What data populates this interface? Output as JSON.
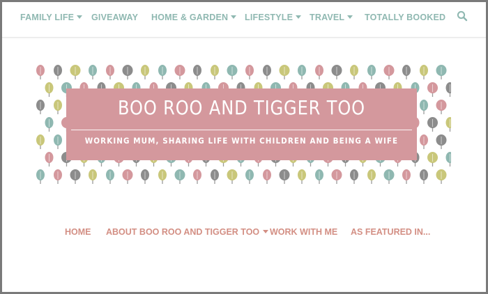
{
  "top_nav": {
    "items": [
      {
        "label": "FAMILY LIFE",
        "dropdown": true
      },
      {
        "label": "GIVEAWAY",
        "dropdown": false
      },
      {
        "label": "HOME & GARDEN",
        "dropdown": true
      },
      {
        "label": "LIFESTYLE",
        "dropdown": true
      },
      {
        "label": "TRAVEL",
        "dropdown": true
      },
      {
        "label": "TOTALLY BOOKED",
        "dropdown": false
      }
    ],
    "search_icon": "search-icon",
    "color": "#8fb8b1"
  },
  "banner": {
    "title": "BOO ROO AND TIGGER TOO",
    "tagline": "WORKING MUM, SHARING LIFE WITH CHILDREN AND BEING A WIFE",
    "box_color": "#d4989d",
    "tree_colors": [
      "#d4989d",
      "#8fb8b1",
      "#c9c77a",
      "#8c8c8c"
    ]
  },
  "main_nav": {
    "items": [
      {
        "label": "HOME",
        "dropdown": false
      },
      {
        "label": "ABOUT BOO ROO AND TIGGER TOO",
        "dropdown": true
      },
      {
        "label": "WORK WITH ME",
        "dropdown": false
      },
      {
        "label": "AS FEATURED IN...",
        "dropdown": false
      }
    ],
    "color": "#d38f84"
  }
}
